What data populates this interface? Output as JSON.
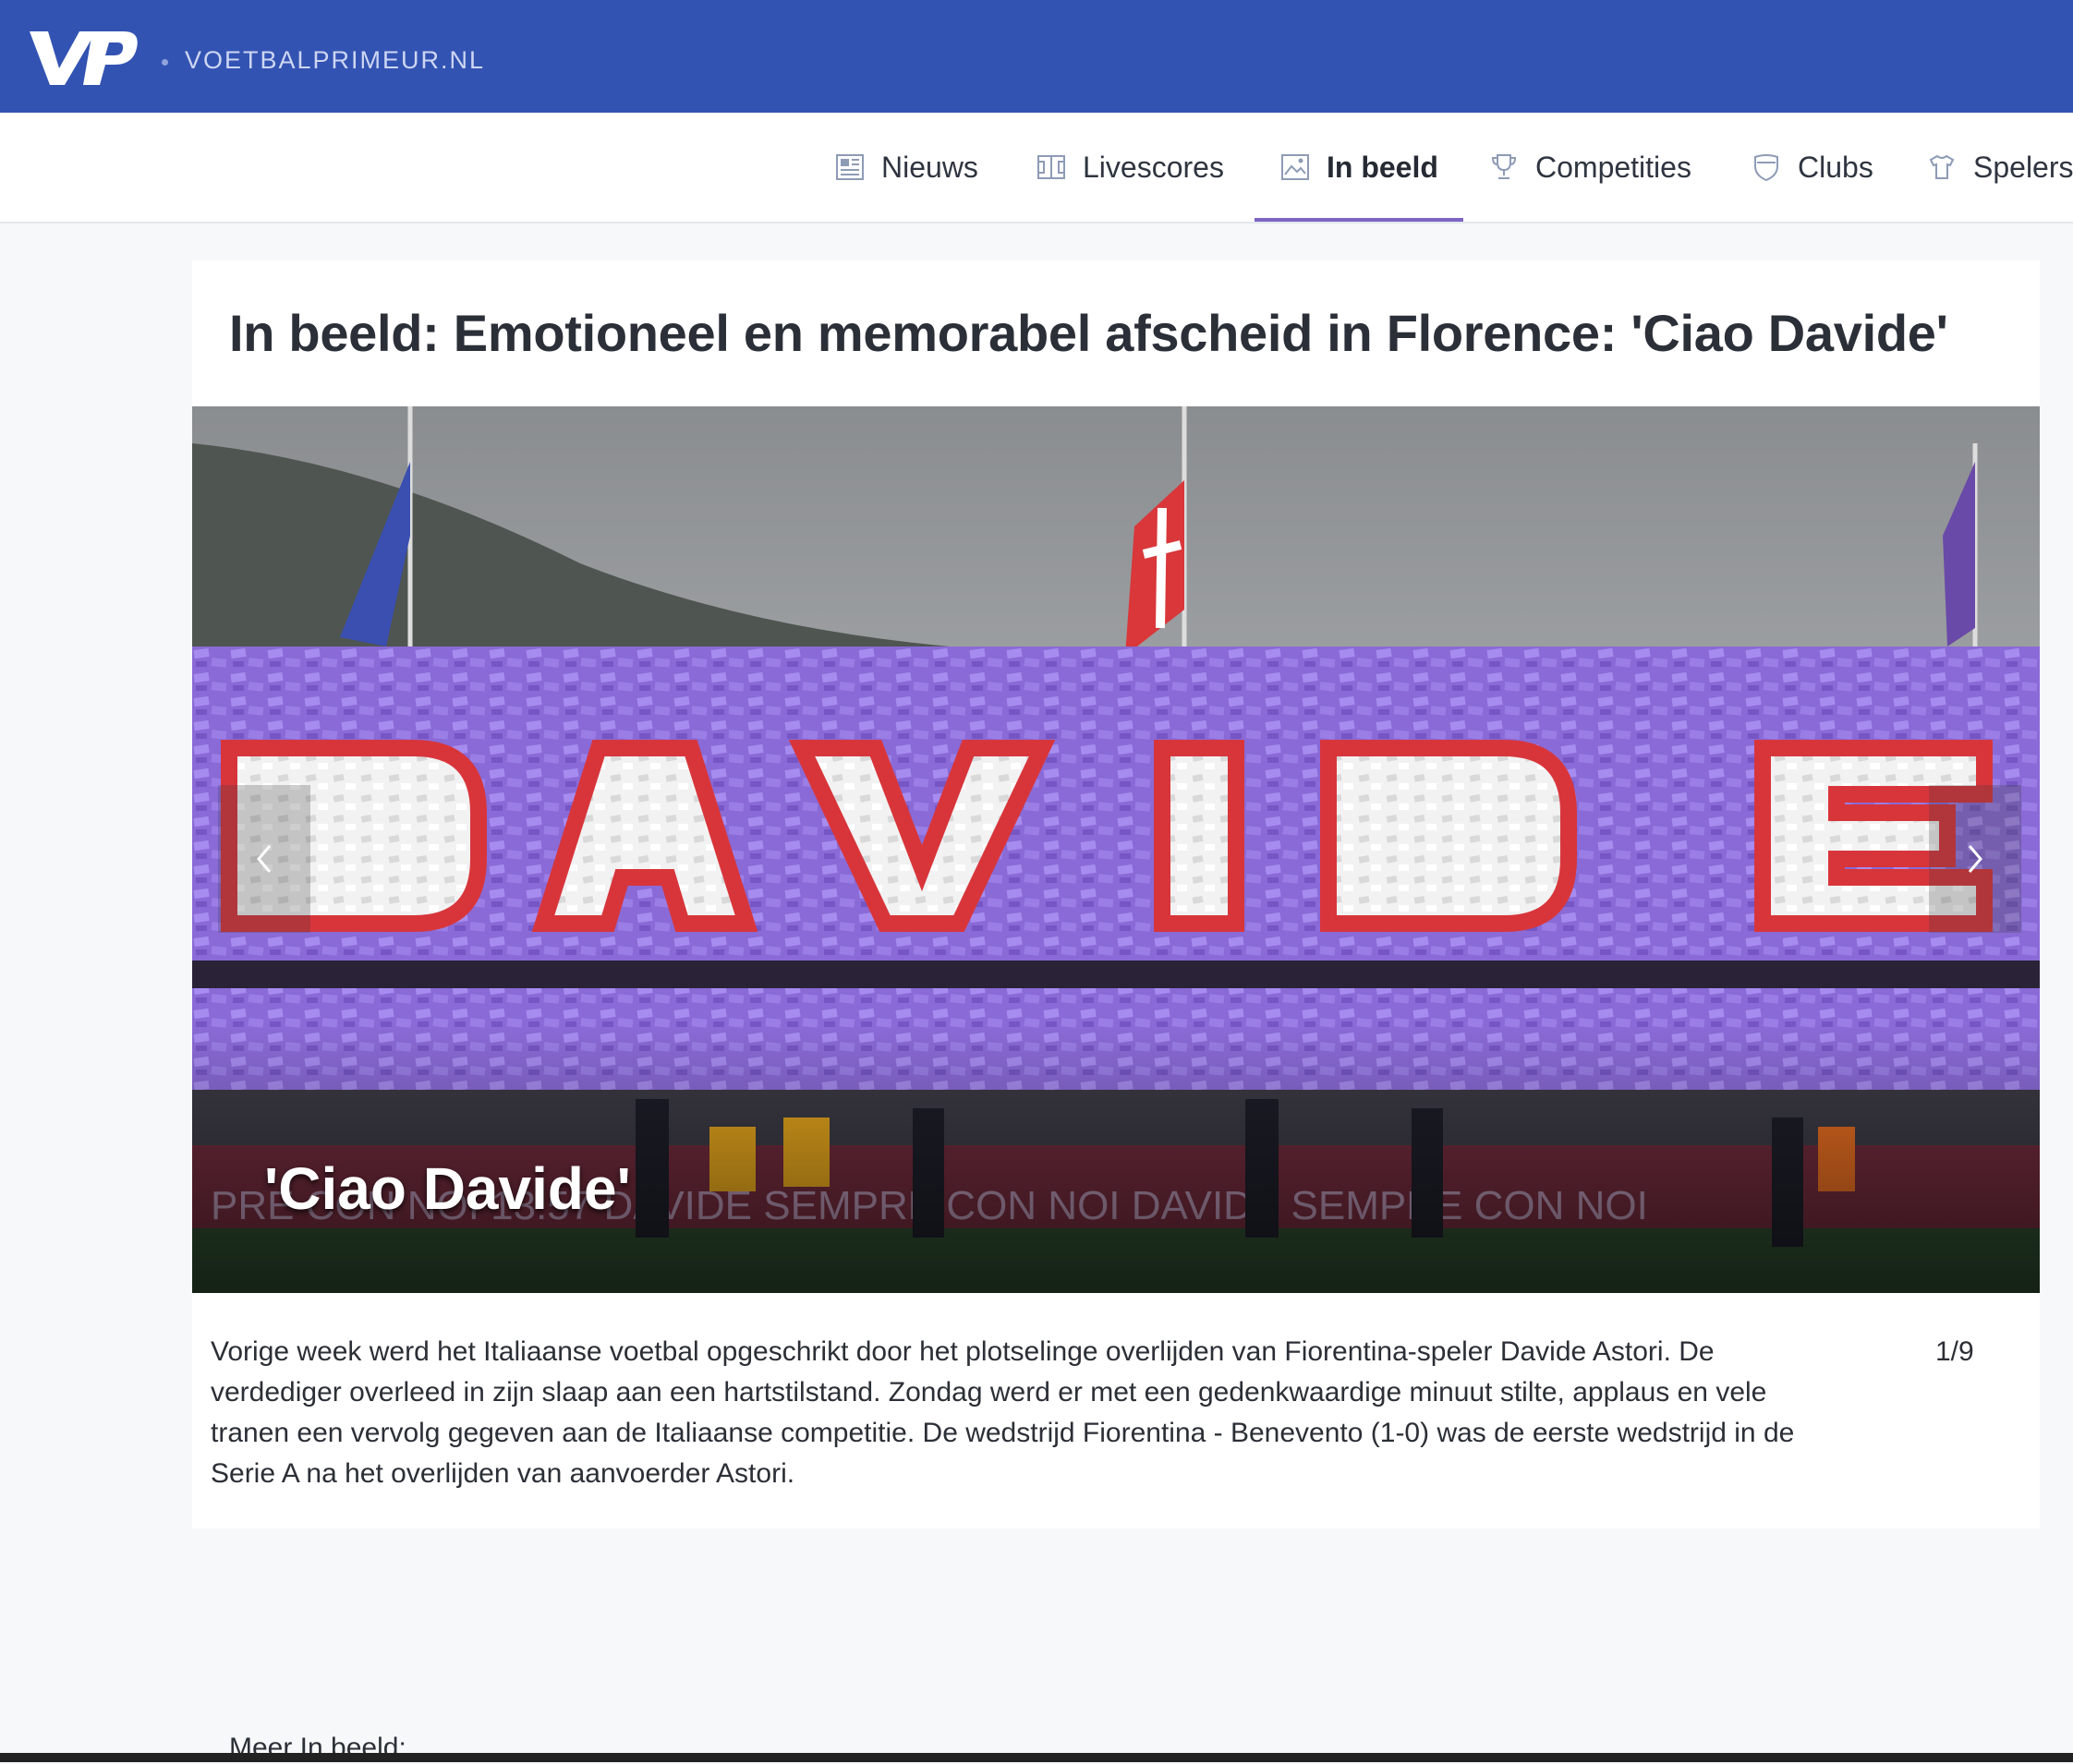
{
  "site": {
    "logo_text": "VP",
    "name": "VOETBALPRIMEUR.NL",
    "brand_color": "#3353b3",
    "accent_color": "#7d64c4"
  },
  "nav": {
    "items": [
      {
        "label": "Nieuws",
        "icon": "newspaper-icon"
      },
      {
        "label": "Livescores",
        "icon": "pitch-icon"
      },
      {
        "label": "In beeld",
        "icon": "picture-icon",
        "active": true
      },
      {
        "label": "Competities",
        "icon": "trophy-icon"
      },
      {
        "label": "Clubs",
        "icon": "shield-icon"
      },
      {
        "label": "Spelers",
        "icon": "shirt-icon"
      }
    ]
  },
  "article": {
    "title": "In beeld: Emotioneel en memorabel afscheid in Florence: 'Ciao Davide'",
    "slide": {
      "caption": "'Ciao Davide'",
      "counter": "1/9",
      "description": "Vorige week werd het Italiaanse voetbal opgeschrikt door het plotselinge overlijden van Fiorentina-speler Davide Astori. De verdediger overleed in zijn slaap aan een hartstilstand. Zondag werd er met een gedenkwaardige minuut stilte, applaus en vele tranen een vervolg gegeven aan de Italiaanse competitie. De wedstrijd Fiorentina - Benevento (1-0) was de eerste wedstrijd in de Serie A na het overlijden van aanvoerder Astori."
    },
    "more_label": "Meer In beeld:"
  }
}
